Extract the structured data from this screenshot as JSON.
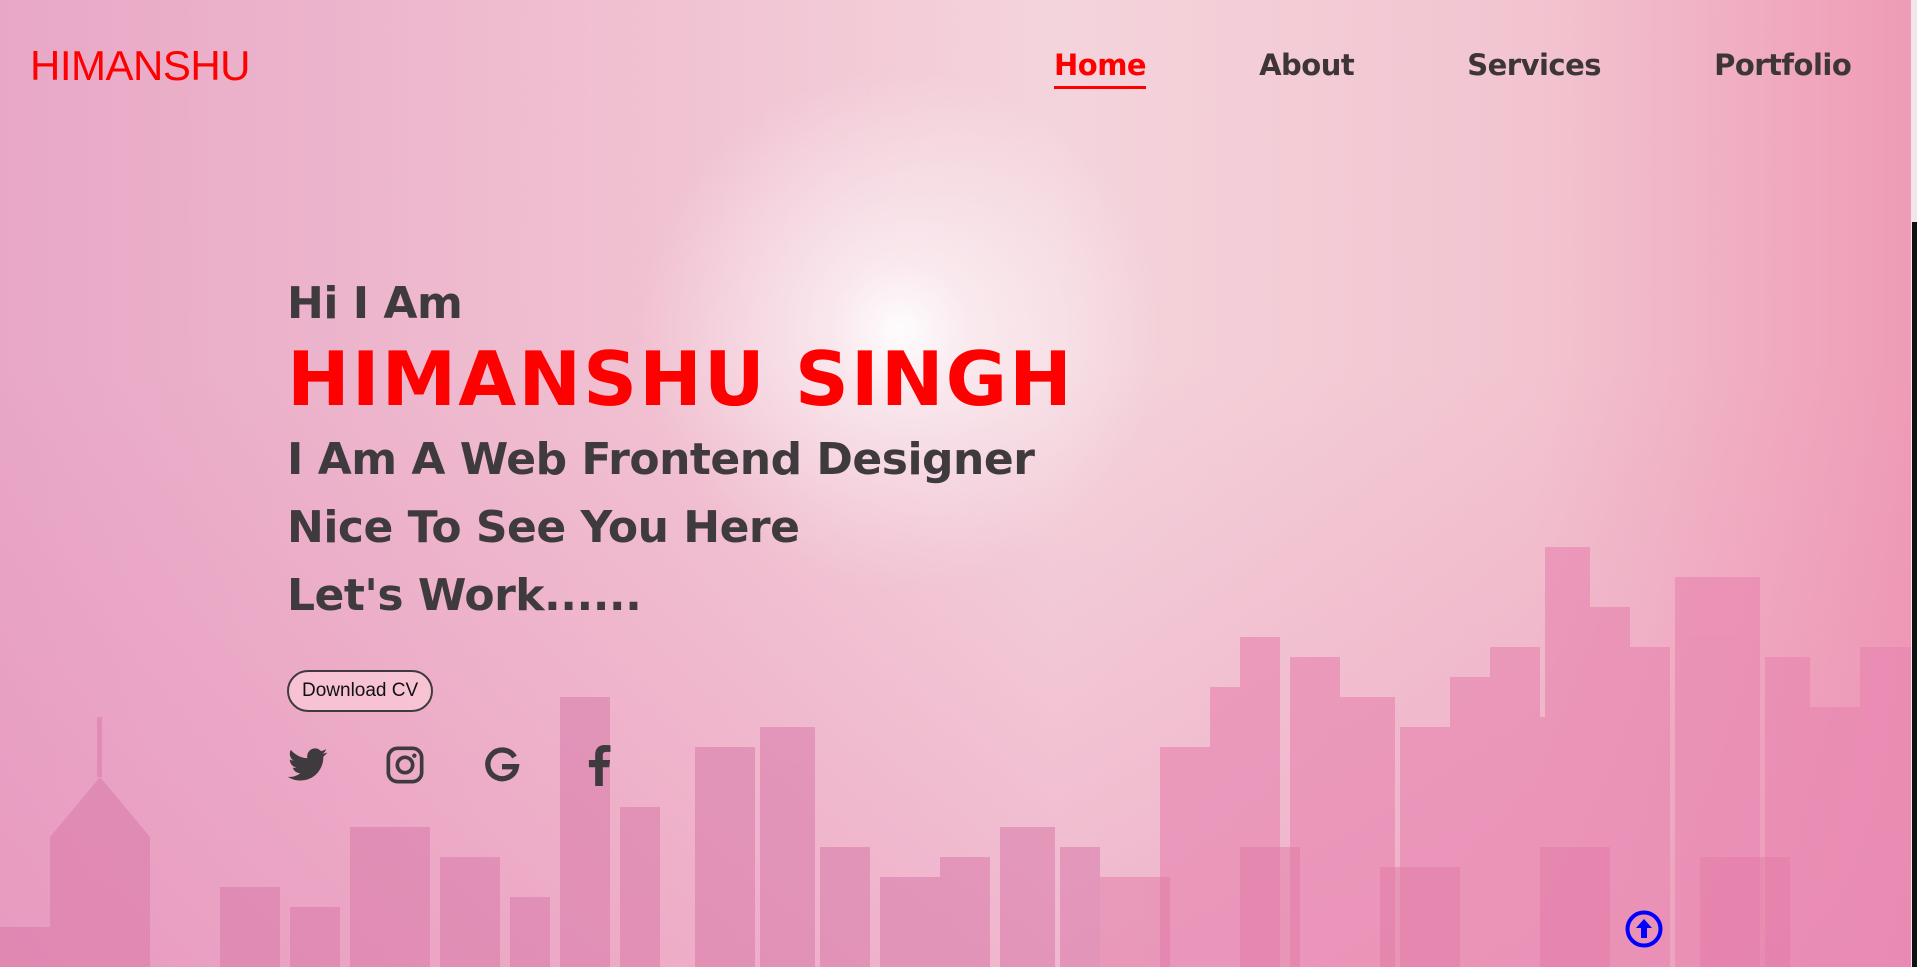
{
  "brand": {
    "logo_text": "HIMANSHU"
  },
  "nav": {
    "items": [
      {
        "label": "Home",
        "active": true
      },
      {
        "label": "About",
        "active": false
      },
      {
        "label": "Services",
        "active": false
      },
      {
        "label": "Portfolio",
        "active": false
      }
    ]
  },
  "hero": {
    "greeting": "Hi I Am",
    "name": "HIMANSHU SINGH",
    "tagline": "I Am A Web Frontend Designer",
    "line2": "Nice To See You Here",
    "line3": "Let's Work......",
    "cv_button_label": "Download CV"
  },
  "socials": [
    {
      "icon": "twitter-icon"
    },
    {
      "icon": "instagram-icon"
    },
    {
      "icon": "google-icon"
    },
    {
      "icon": "facebook-icon"
    }
  ],
  "scroll_top": {
    "icon": "arrow-up-circle-icon"
  },
  "colors": {
    "accent": "#ff0000",
    "text": "#3f3a3d",
    "scroll_top": "#0000ff"
  }
}
